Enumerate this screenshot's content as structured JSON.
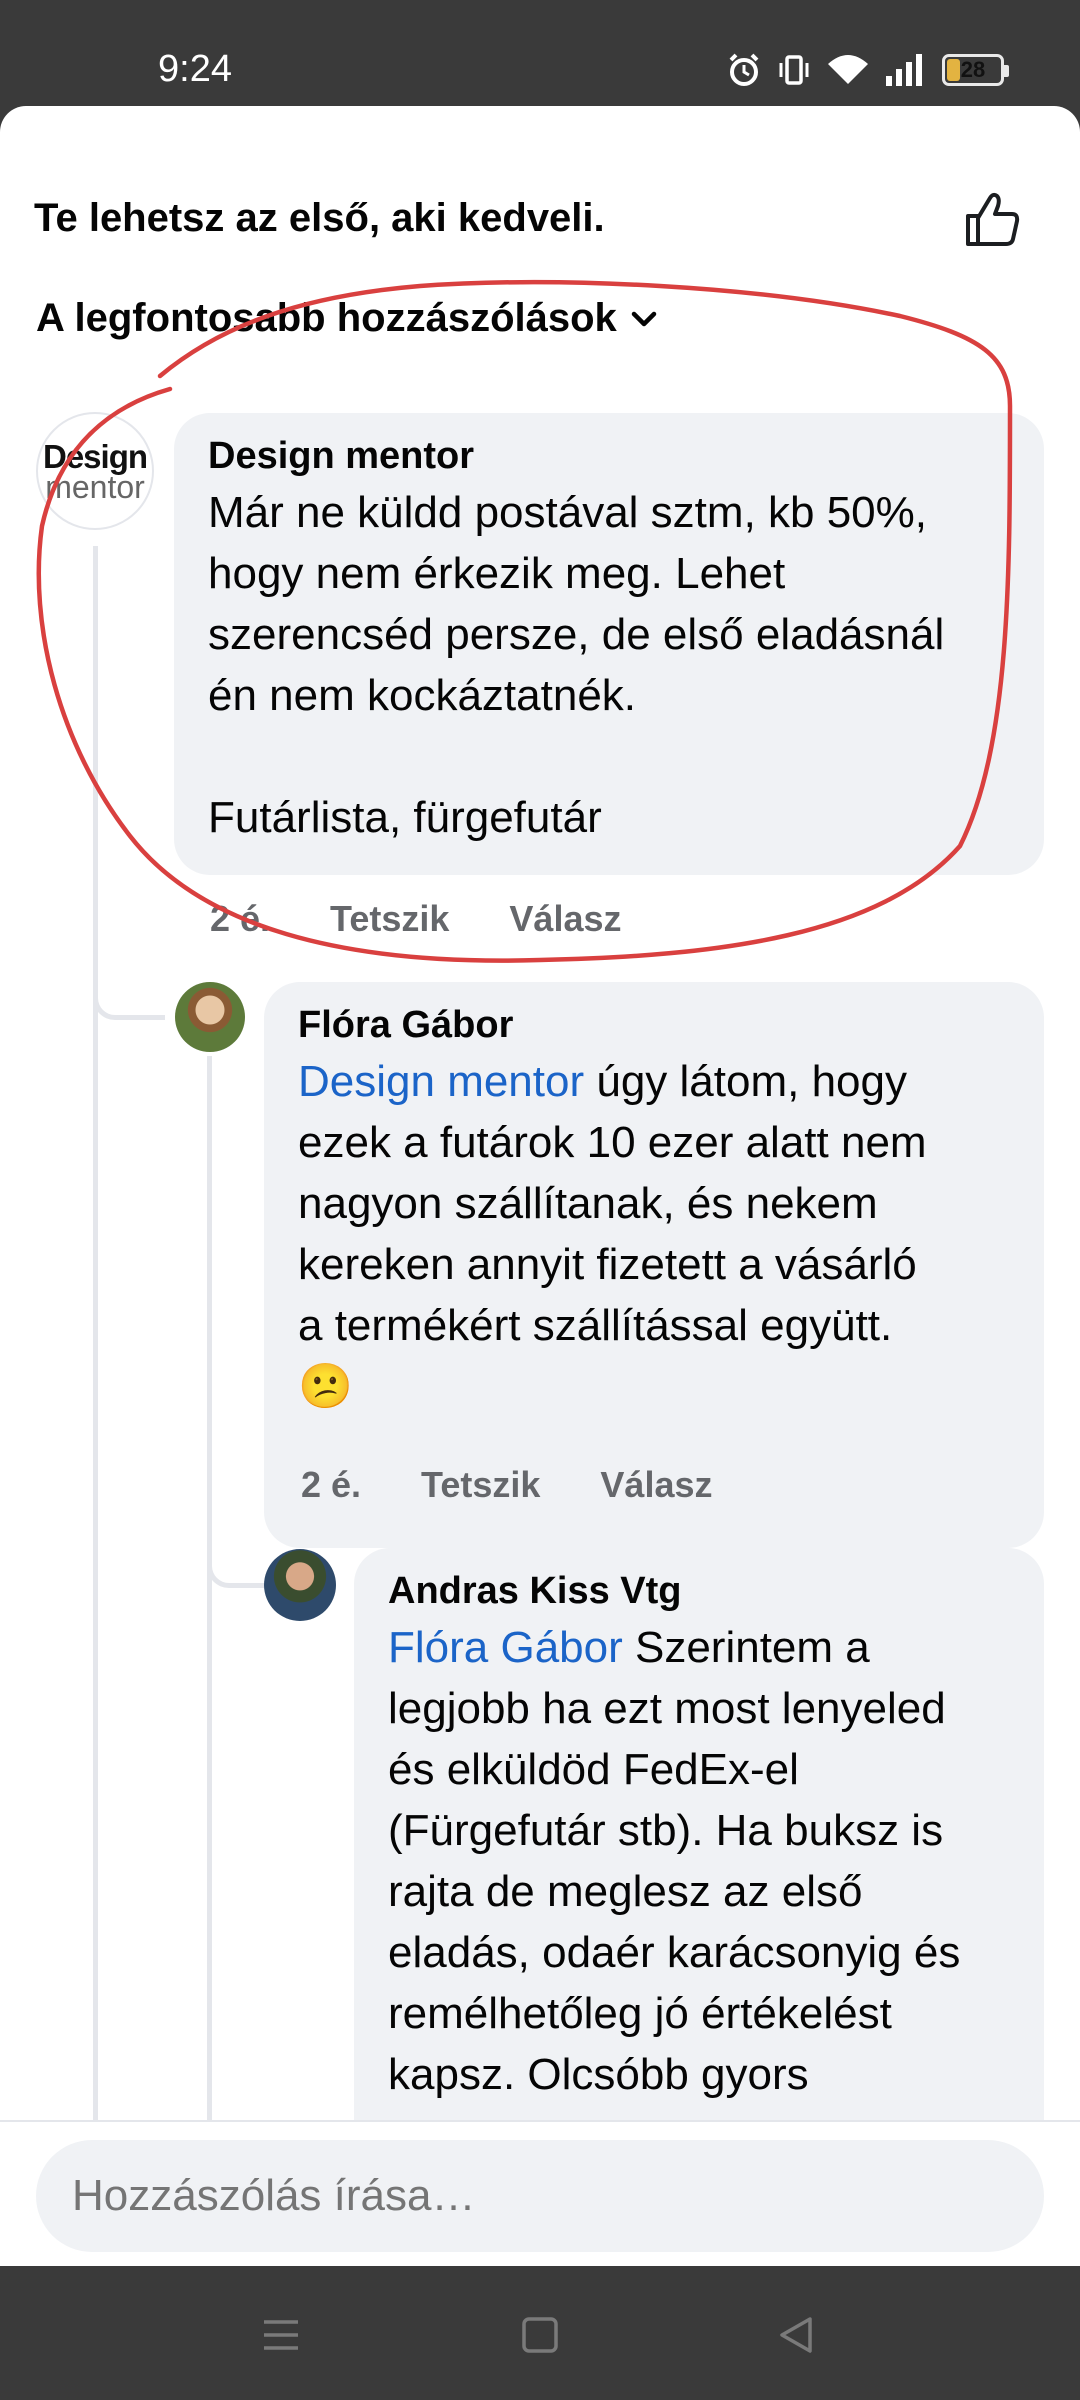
{
  "status_bar": {
    "time": "9:24",
    "battery_level": "28",
    "icons": [
      "alarm-icon",
      "vibrate-icon",
      "wifi-icon",
      "signal-icon",
      "battery-icon"
    ]
  },
  "reactions": {
    "text": "Te lehetsz az első, aki kedveli.",
    "icon": "like-thumb-icon"
  },
  "sort": {
    "label": "A legfontosabb hozzászólások"
  },
  "comments": [
    {
      "author": "Design mentor",
      "avatar_text_top": "Design",
      "avatar_text_bottom": "mentor",
      "text": "Már ne küldd postával sztm, kb 50%,\nhogy nem érkezik meg. Lehet\nszerencséd persze, de első eladásnál\nén nem kockáztatnék.\n\nFutárlista, fürgefutár",
      "time": "2 é.",
      "like_label": "Tetszik",
      "reply_label": "Válasz"
    },
    {
      "author": "Flóra Gábor",
      "mention": "Design mentor",
      "text": " úgy látom, hogy\nezek a futárok 10 ezer alatt nem\nnagyon szállítanak, és nekem\nkereken annyit fizetett a vásárló\na termékért szállítással együtt.\n😕",
      "time": "2 é.",
      "like_label": "Tetszik",
      "reply_label": "Válasz"
    },
    {
      "author": "Andras Kiss Vtg",
      "mention": "Flóra Gábor",
      "text": " Szerintem a\nlegjobb ha ezt most lenyeled\nés elküldöd FedEx-el\n(Fürgefutár stb). Ha buksz is\nrajta de meglesz az első\neladás, odaér karácsonyig és\nremélhetőleg jó értékelést\nkapsz. Olcsóbb gyors"
    }
  ],
  "composer": {
    "placeholder": "Hozzászólás írása…"
  },
  "nav_bar": {
    "icons": [
      "menu-icon",
      "home-square-icon",
      "back-triangle-icon"
    ]
  },
  "colors": {
    "mention": "#1b64c8",
    "bubble": "#f0f2f5",
    "annotation": "#d9403f"
  }
}
